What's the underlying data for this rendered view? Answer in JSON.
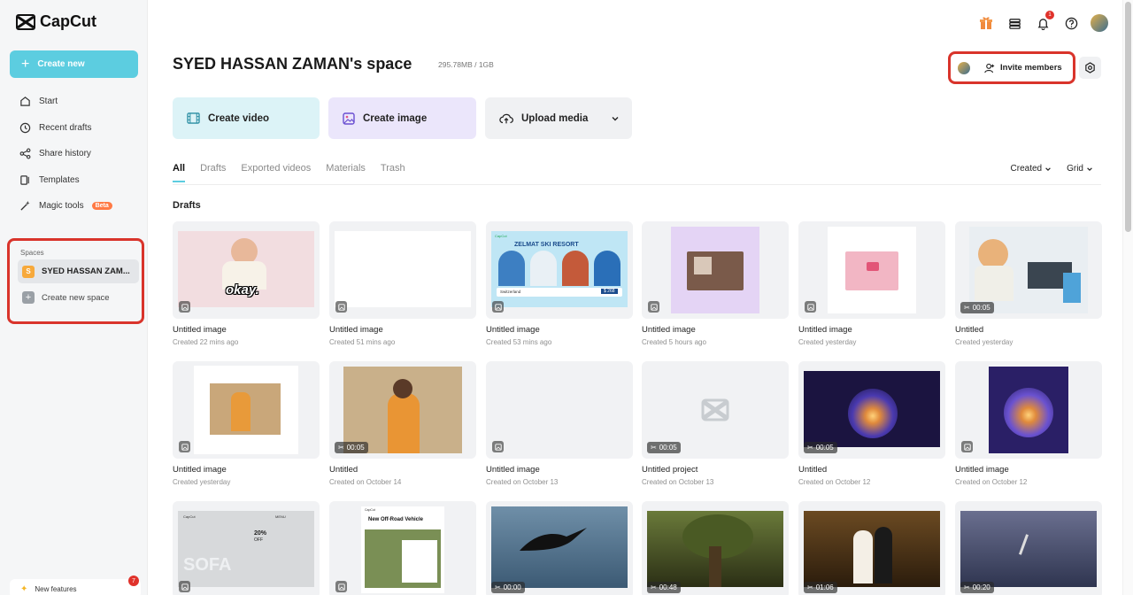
{
  "app": {
    "name": "CapCut"
  },
  "sidebar": {
    "create_new": "Create new",
    "items": [
      {
        "label": "Start",
        "icon": "home-icon"
      },
      {
        "label": "Recent drafts",
        "icon": "clock-icon"
      },
      {
        "label": "Share history",
        "icon": "share-icon"
      },
      {
        "label": "Templates",
        "icon": "templates-icon"
      },
      {
        "label": "Magic tools",
        "icon": "magic-wand-icon",
        "badge": "Beta"
      }
    ],
    "spaces_label": "Spaces",
    "space_name": "SYED HASSAN ZAM...",
    "space_initial": "S",
    "create_space": "Create new space",
    "new_features": "New features",
    "new_features_count": "7"
  },
  "topbar": {
    "notification_count": "1"
  },
  "header": {
    "title": "SYED HASSAN ZAMAN's space",
    "storage": "295.78MB / 1GB",
    "invite": "Invite members"
  },
  "actions": {
    "video": "Create video",
    "image": "Create image",
    "upload": "Upload media"
  },
  "tabs": [
    "All",
    "Drafts",
    "Exported videos",
    "Materials",
    "Trash"
  ],
  "sort": {
    "order": "Created",
    "view": "Grid"
  },
  "section": "Drafts",
  "cards": [
    {
      "title": "Untitled image",
      "sub": "Created 22 mins ago",
      "duration": ""
    },
    {
      "title": "Untitled image",
      "sub": "Created 51 mins ago",
      "duration": ""
    },
    {
      "title": "Untitled image",
      "sub": "Created 53 mins ago",
      "duration": ""
    },
    {
      "title": "Untitled image",
      "sub": "Created 5 hours ago",
      "duration": ""
    },
    {
      "title": "Untitled image",
      "sub": "Created yesterday",
      "duration": ""
    },
    {
      "title": "Untitled",
      "sub": "Created yesterday",
      "duration": "00:05"
    },
    {
      "title": "Untitled image",
      "sub": "Created yesterday",
      "duration": ""
    },
    {
      "title": "Untitled",
      "sub": "Created on October 14",
      "duration": "00:05"
    },
    {
      "title": "Untitled image",
      "sub": "Created on October 13",
      "duration": ""
    },
    {
      "title": "Untitled project",
      "sub": "Created on October 13",
      "duration": "00:05"
    },
    {
      "title": "Untitled",
      "sub": "Created on October 12",
      "duration": "00:05"
    },
    {
      "title": "Untitled image",
      "sub": "Created on October 12",
      "duration": ""
    },
    {
      "title": "",
      "sub": "",
      "duration": ""
    },
    {
      "title": "",
      "sub": "",
      "duration": ""
    },
    {
      "title": "",
      "sub": "",
      "duration": "00:00"
    },
    {
      "title": "",
      "sub": "",
      "duration": "00:48"
    },
    {
      "title": "",
      "sub": "",
      "duration": "01:06"
    },
    {
      "title": "",
      "sub": "",
      "duration": "00:20"
    }
  ],
  "thumb_texts": {
    "ski_title": "ZELMAT SKI RESORT",
    "ski_logo": "CapCut",
    "ski_place": "Switzerland",
    "ski_price": "$ 268",
    "okay": "okay.",
    "sofa": "SOFA",
    "sofa_logo": "CapCut",
    "sofa_menu": "MENU",
    "sofa_pct": "20%",
    "sofa_off": "OFF",
    "vehicle_logo": "CapCut",
    "vehicle_title": "New Off-Road Vehicle"
  },
  "colors": {
    "accent": "#5ccde0",
    "highlight": "#d9342b"
  }
}
